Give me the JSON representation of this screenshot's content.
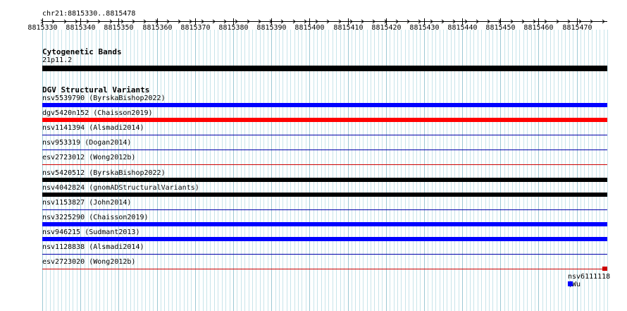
{
  "region": "chr21:8815330..8815478",
  "ruler": {
    "start": 8815330,
    "end": 8815478,
    "labels": [
      "8815330",
      "8815340",
      "8815350",
      "8815360",
      "8815370",
      "8815380",
      "8815390",
      "8815400",
      "8815410",
      "8815420",
      "8815430",
      "8815440",
      "8815450",
      "8815460",
      "8815470"
    ]
  },
  "tracks": {
    "cytoband": {
      "title": "Cytogenetic Bands",
      "band_label": "21p11.2",
      "color": "#000000"
    },
    "dgv": {
      "title": "DGV Structural Variants",
      "features": [
        {
          "label": "nsv5539790 (ByrskaBishop2022)",
          "color": "#0000ff",
          "style": "thick"
        },
        {
          "label": "dgv5420n152 (Chaisson2019)",
          "color": "#ff0000",
          "style": "thick"
        },
        {
          "label": "nsv1141394 (Alsmadi2014)",
          "color": "#0000aa",
          "style": "thin"
        },
        {
          "label": "nsv953319 (Dogan2014)",
          "color": "#0000aa",
          "style": "thin"
        },
        {
          "label": "esv2723012 (Wong2012b)",
          "color": "#cc0000",
          "style": "thin"
        },
        {
          "label": "nsv5420512 (ByrskaBishop2022)",
          "color": "#000000",
          "style": "thick"
        },
        {
          "label": "nsv4042824 (gnomADStructuralVariants)",
          "color": "#000000",
          "style": "thick"
        },
        {
          "label": "nsv1153827 (John2014)",
          "color": "#0000aa",
          "style": "thin"
        },
        {
          "label": "nsv3225290 (Chaisson2019)",
          "color": "#0000ff",
          "style": "thick"
        },
        {
          "label": "nsv946215 (Sudmant2013)",
          "color": "#0000ff",
          "style": "thick"
        },
        {
          "label": "nsv1128838 (Alsmadi2014)",
          "color": "#0000aa",
          "style": "thin"
        },
        {
          "label": "esv2723020 (Wong2012b)",
          "color": "#cc0000",
          "style": "thin_end_box"
        }
      ],
      "extra_feature": {
        "label": "nsv6111118 (Wu",
        "color": "#0000ff"
      }
    }
  }
}
